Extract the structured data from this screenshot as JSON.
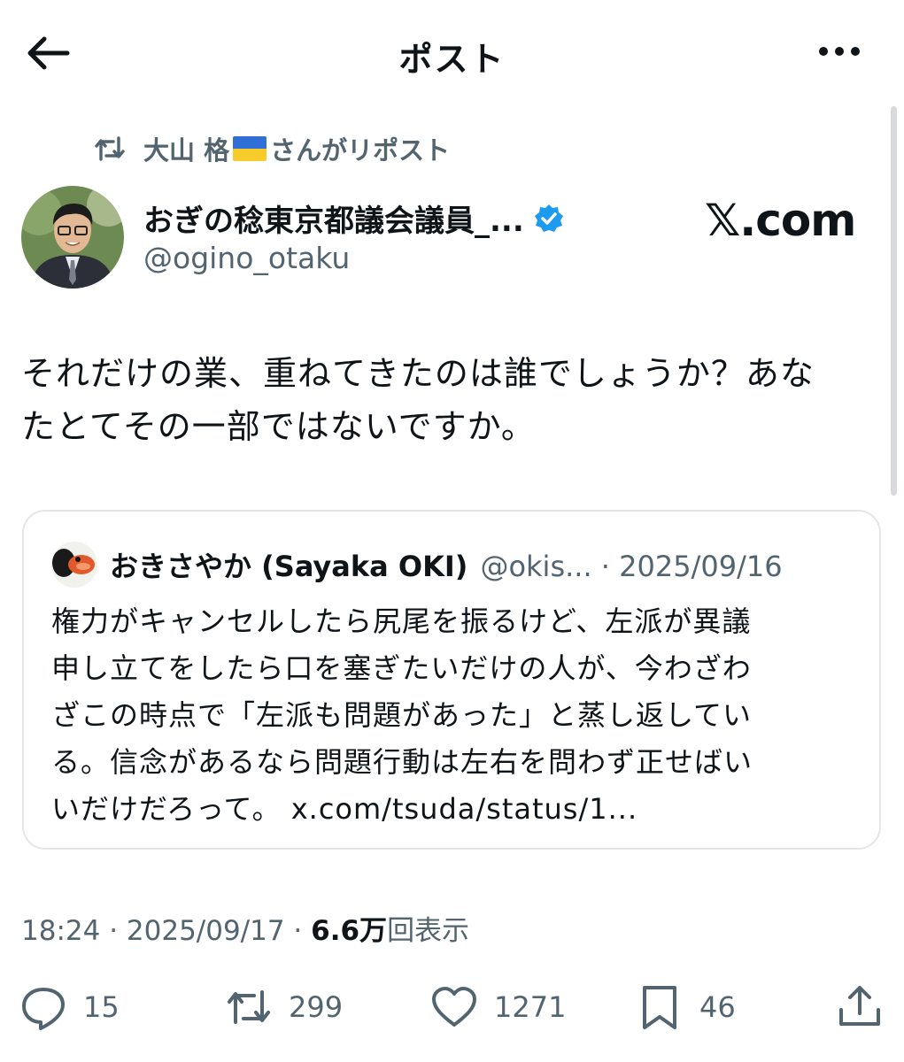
{
  "header": {
    "title": "ポスト",
    "back_icon": "arrow-left-icon",
    "more_icon": "more-horizontal-icon"
  },
  "repost": {
    "name_part1": "大山 格",
    "name_part2": "さんがリポスト",
    "icon": "repost-icon"
  },
  "author": {
    "name": "おぎの稔東京都議会議員_...",
    "handle": "@ogino_otaku",
    "verified_icon": "verified-badge-icon"
  },
  "watermark": "𝕏.com",
  "post": {
    "line1": "それだけの業、重ねてきたのは誰でしょうか？あな",
    "line2": "たとてその一部ではないですか。"
  },
  "quote": {
    "name": "おきさやか (Sayaka OKI)",
    "meta": "@okis... · 2025/09/16",
    "lines": [
      "権力がキャンセルしたら尻尾を振るけど、左派が異議",
      "申し立てをしたら口を塞ぎたいだけの人が、今わざわ",
      "ざこの時点で「左派も問題があった」と蒸し返してい",
      "る。信念があるなら問題行動は左右を問わず正せばい",
      "いだけだろって。"
    ],
    "link": "x.com/tsuda/status/1..."
  },
  "timestamp": {
    "time": "18:24 · 2025/09/17 · ",
    "views_count": "6.6万",
    "views_label": "回表示"
  },
  "actions": {
    "reply": "15",
    "repost": "299",
    "like": "1271",
    "bookmark": "46"
  },
  "colors": {
    "text": "#0f1419",
    "secondary": "#536471",
    "verified": "#1d9bf0",
    "border": "#e3e6e9"
  }
}
